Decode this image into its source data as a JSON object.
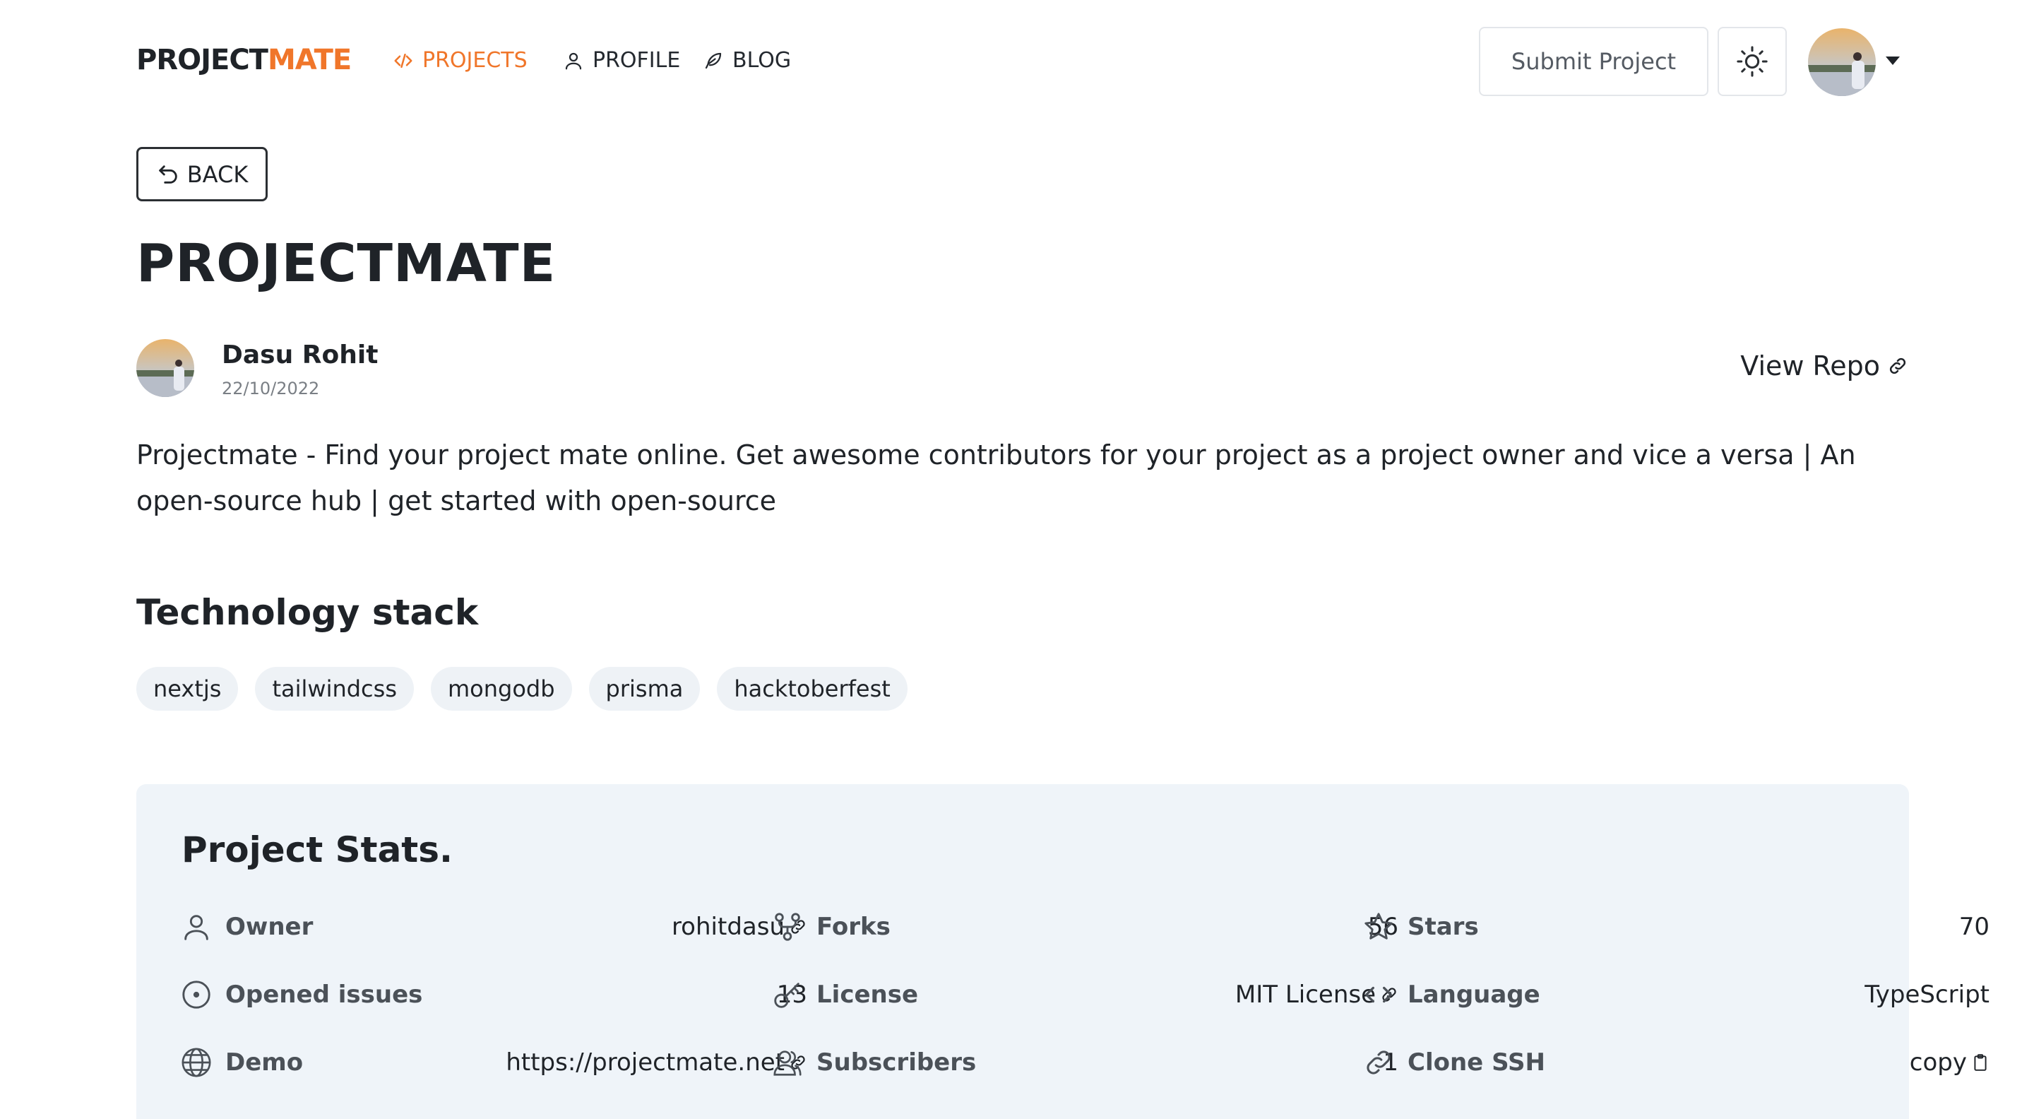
{
  "nav": {
    "logo_part1": "PROJECT",
    "logo_part2": "MATE",
    "links": [
      {
        "label": "PROJECTS",
        "icon": "code-icon",
        "active": true
      },
      {
        "label": "PROFILE",
        "icon": "user-icon",
        "active": false
      },
      {
        "label": "BLOG",
        "icon": "feather-icon",
        "active": false
      }
    ],
    "submit_label": "Submit Project",
    "theme_icon": "sun-icon",
    "avatar_icon": "avatar"
  },
  "back_label": "BACK",
  "project": {
    "title": "PROJECTMATE",
    "author": "Dasu Rohit",
    "date": "22/10/2022",
    "view_repo": "View Repo",
    "description": "Projectmate - Find your project mate online. Get awesome contributors for your project as a project owner and vice a versa | An open-source hub | get started with open-source"
  },
  "tech": {
    "title": "Technology stack",
    "tags": [
      "nextjs",
      "tailwindcss",
      "mongodb",
      "prisma",
      "hacktoberfest"
    ]
  },
  "stats": {
    "title": "Project Stats.",
    "items": [
      {
        "label": "Owner",
        "value": "rohitdasu",
        "icon": "user-icon"
      },
      {
        "label": "Forks",
        "value": "56",
        "icon": "fork-icon"
      },
      {
        "label": "Stars",
        "value": "70",
        "icon": "star-icon"
      },
      {
        "label": "Opened issues",
        "value": "13",
        "icon": "issue-icon"
      },
      {
        "label": "License",
        "value": "MIT License",
        "icon": "key-icon"
      },
      {
        "label": "Language",
        "value": "TypeScript",
        "icon": "code-icon"
      },
      {
        "label": "Demo",
        "value": "https://projectmate.net",
        "icon": "globe-icon"
      },
      {
        "label": "Subscribers",
        "value": "1",
        "icon": "users-icon"
      },
      {
        "label": "Clone SSH",
        "value": "copy",
        "icon": "link-icon"
      }
    ]
  },
  "colors": {
    "accent": "#f0762a",
    "stats_bg": "#eff4f9",
    "tag_bg": "#eef2f6"
  }
}
